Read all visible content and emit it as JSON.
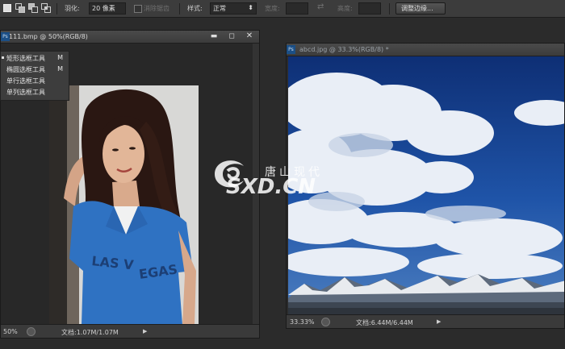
{
  "options_bar": {
    "feather_label": "羽化:",
    "feather_value": "20 像素",
    "antialias_label": "消除锯齿",
    "style_label": "样式:",
    "style_value": "正常",
    "width_label": "宽度:",
    "height_label": "高度:",
    "refine_edge_label": "调整边缘..."
  },
  "left_doc": {
    "title": "111.bmp @ 50%(RGB/8)",
    "zoom": "50%",
    "doc_info": "文档:1.07M/1.07M"
  },
  "tool_flyout": {
    "items": [
      {
        "name": "矩形选框工具",
        "key": "M"
      },
      {
        "name": "椭圆选框工具",
        "key": "M"
      },
      {
        "name": "单行选框工具",
        "key": ""
      },
      {
        "name": "单列选框工具",
        "key": ""
      }
    ]
  },
  "right_doc": {
    "title": "abcd.jpg @ 33.3%(RGB/8) *",
    "zoom": "33.33%",
    "doc_info": "文档:6.44M/6.44M"
  },
  "watermark": {
    "cn": "唐山现代",
    "en": "SXD.CN"
  },
  "icons": [
    "new-selection-icon",
    "add-selection-icon",
    "subtract-selection-icon",
    "intersect-selection-icon",
    "swap-icon",
    "photoshop-doc-icon",
    "minimize-icon",
    "restore-icon",
    "close-icon",
    "status-menu-icon",
    "play-arrow-icon"
  ],
  "colors": {
    "panel": "#3c3c3c",
    "document_bg": "#2a2a2a",
    "ps_blue": "#1b4f86"
  }
}
